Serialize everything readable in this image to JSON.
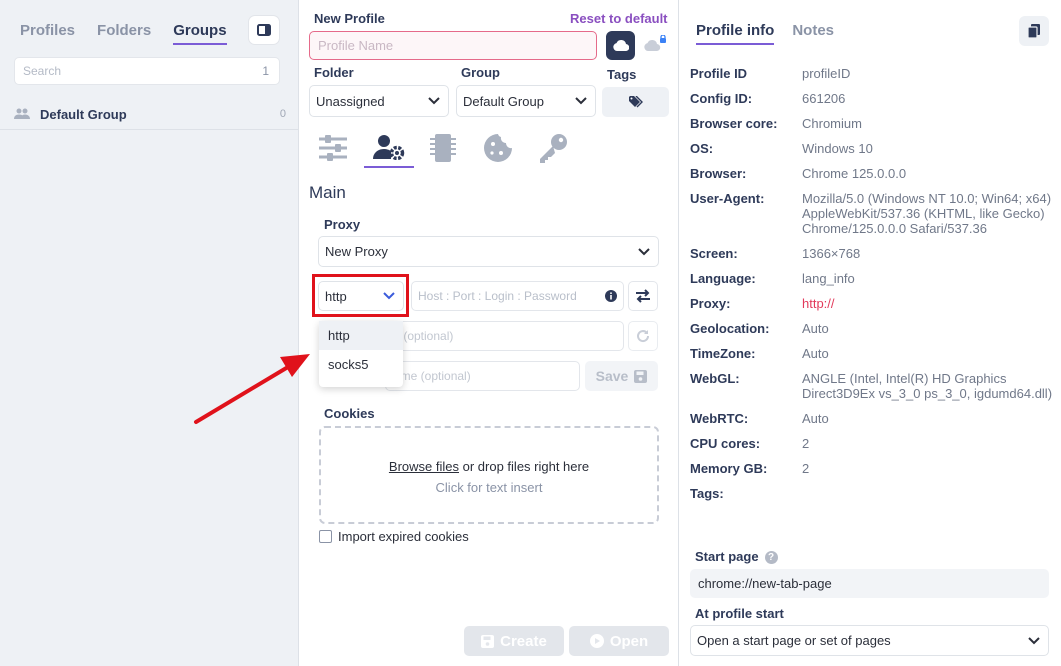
{
  "left": {
    "tabs": [
      "Profiles",
      "Folders",
      "Groups"
    ],
    "active_tab": "Groups",
    "search_placeholder": "Search",
    "search_count": "1",
    "groups": [
      {
        "name": "Default Group",
        "count": "0"
      }
    ]
  },
  "form": {
    "title": "New Profile",
    "reset_label": "Reset to default",
    "name_placeholder": "Profile Name",
    "folder_label": "Folder",
    "folder_value": "Unassigned",
    "group_label": "Group",
    "group_value": "Default Group",
    "tags_label": "Tags",
    "section_title": "Main",
    "proxy_label": "Proxy",
    "proxy_select": "New Proxy",
    "proxy_type": "http",
    "proxy_host_placeholder": "Host : Port : Login : Password",
    "proxy_options": [
      "http",
      "socks5"
    ],
    "link_placeholder": "k (optional)",
    "name_opt_placeholder": "ame (optional)",
    "save_label": "Save",
    "cookies_label": "Cookies",
    "browse_label": "Browse files",
    "drop_label": "or drop files right here",
    "click_insert": "Click for text insert",
    "import_expired": "Import expired cookies",
    "create_label": "Create",
    "open_label": "Open"
  },
  "info": {
    "tabs": [
      "Profile info",
      "Notes"
    ],
    "rows": [
      {
        "k": "Profile ID",
        "v": "profileID"
      },
      {
        "k": "Config ID:",
        "v": "661206"
      },
      {
        "k": "Browser core:",
        "v": "Chromium"
      },
      {
        "k": "OS:",
        "v": "Windows 10"
      },
      {
        "k": "Browser:",
        "v": "Chrome 125.0.0.0"
      },
      {
        "k": "User-Agent:",
        "v": "Mozilla/5.0 (Windows NT 10.0; Win64; x64) AppleWebKit/537.36 (KHTML, like Gecko) Chrome/125.0.0.0 Safari/537.36"
      },
      {
        "k": "Screen:",
        "v": "1366×768"
      },
      {
        "k": "Language:",
        "v": "lang_info"
      },
      {
        "k": "Proxy:",
        "v": "http://"
      },
      {
        "k": "Geolocation:",
        "v": "Auto"
      },
      {
        "k": "TimeZone:",
        "v": "Auto"
      },
      {
        "k": "WebGL:",
        "v": "ANGLE (Intel, Intel(R) HD Graphics Direct3D9Ex vs_3_0 ps_3_0, igdumd64.dll)"
      },
      {
        "k": "WebRTC:",
        "v": "Auto"
      },
      {
        "k": "CPU cores:",
        "v": "2"
      },
      {
        "k": "Memory GB:",
        "v": "2"
      },
      {
        "k": "Tags:",
        "v": ""
      }
    ],
    "start_page_label": "Start page",
    "start_page_value": "chrome://new-tab-page",
    "at_start_label": "At profile start",
    "at_start_value": "Open a start page or set of pages"
  },
  "colors": {
    "accent": "#7b5cd6",
    "dark": "#2e3a59",
    "annotation": "#e0121b",
    "link": "#8a4fc0"
  }
}
